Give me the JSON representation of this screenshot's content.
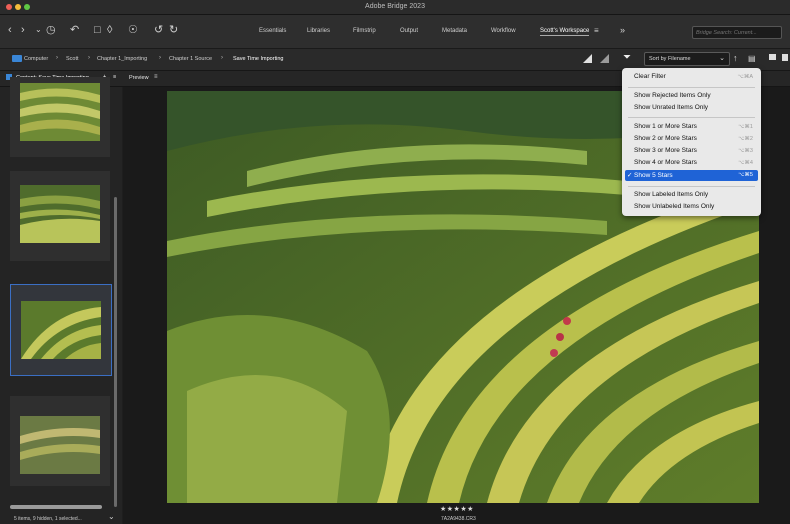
{
  "window": {
    "title": "Adobe Bridge 2023"
  },
  "workspaces": [
    {
      "label": "Essentials"
    },
    {
      "label": "Libraries"
    },
    {
      "label": "Filmstrip"
    },
    {
      "label": "Output"
    },
    {
      "label": "Metadata"
    },
    {
      "label": "Workflow"
    },
    {
      "label": "Scott's Workspace"
    }
  ],
  "more_symbol": "»",
  "search": {
    "placeholder": "Bridge Search: Current..."
  },
  "breadcrumb": [
    "Computer",
    "Scott",
    "Chapter 1_Importing",
    "Chapter 1 Source",
    "Save Time Importing"
  ],
  "sort": {
    "value": "Sort by Filename"
  },
  "panels": {
    "content_tab": "Content: Save Time Importing",
    "preview_tab": "Preview"
  },
  "status": "5 items, 9 hidden, 1 selected...",
  "preview": {
    "stars": "★★★★★",
    "filename": "7A2A9438.CR3"
  },
  "filter_menu": {
    "items": [
      {
        "label": "Clear Filter",
        "shortcut": "⌥⌘A"
      },
      {
        "label": "Show Rejected Items Only",
        "shortcut": ""
      },
      {
        "label": "Show Unrated Items Only",
        "shortcut": ""
      },
      {
        "label": "Show 1 or More Stars",
        "shortcut": "⌥⌘1"
      },
      {
        "label": "Show 2 or More Stars",
        "shortcut": "⌥⌘2"
      },
      {
        "label": "Show 3 or More Stars",
        "shortcut": "⌥⌘3"
      },
      {
        "label": "Show 4 or More Stars",
        "shortcut": "⌥⌘4"
      },
      {
        "label": "Show 5 Stars",
        "shortcut": "⌥⌘5"
      },
      {
        "label": "Show Labeled Items Only",
        "shortcut": ""
      },
      {
        "label": "Show Unlabeled Items Only",
        "shortcut": ""
      }
    ],
    "checked_mark": "✓"
  },
  "colors": {
    "accent": "#1f63d6",
    "selection_border": "#3b6fc4",
    "folder": "#3a86d6"
  }
}
